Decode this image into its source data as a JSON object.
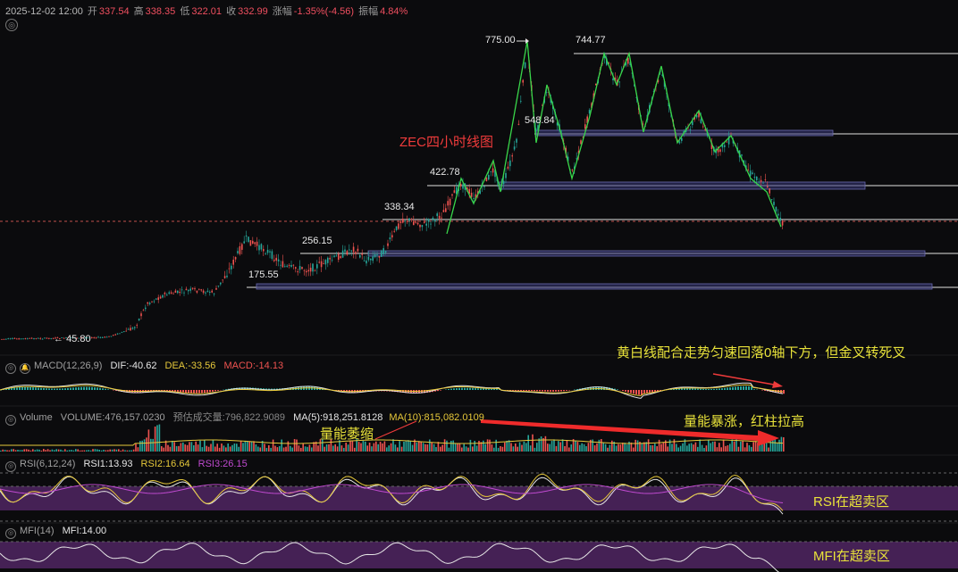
{
  "header": {
    "datetime": "2025-12-02 12:00",
    "open_label": "开",
    "open": "337.54",
    "high_label": "高",
    "high": "338.35",
    "low_label": "低",
    "low": "322.01",
    "close_label": "收",
    "close": "332.99",
    "change_label": "涨幅",
    "change": "-1.35%(-4.56)",
    "amplitude_label": "振幅",
    "amplitude": "4.84%"
  },
  "chart_title": "ZEC四小时线图",
  "price_labels": {
    "p775": "775.00",
    "p744": "744.77",
    "p548": "548.84",
    "p422": "422.78",
    "p338": "338.34",
    "p256": "256.15",
    "p175": "175.55",
    "p45": "45.80"
  },
  "macd": {
    "name": "MACD(12,26,9)",
    "dif": "DIF:-40.62",
    "dea": "DEA:-33.56",
    "macd": "MACD:-14.13",
    "annotation": "黄白线配合走势匀速回落0轴下方，但金叉转死叉"
  },
  "volume": {
    "name": "Volume",
    "volume": "VOLUME:476,157.0230",
    "est": "预估成交量:796,822.9089",
    "ma5": "MA(5):918,251.8128",
    "ma10": "MA(10):815,082.0109",
    "annotation_left": "量能萎缩",
    "annotation_right": "量能暴涨，红柱拉高"
  },
  "rsi": {
    "name": "RSI(6,12,24)",
    "rsi1": "RSI1:13.93",
    "rsi2": "RSI2:16.64",
    "rsi3": "RSI3:26.15",
    "zone": "RSI在超卖区"
  },
  "mfi": {
    "name": "MFI(14)",
    "value": "MFI:14.00",
    "zone": "MFI在超卖区"
  },
  "colors": {
    "up": "#26a69a",
    "down": "#ef5350",
    "accent_yellow": "#e8e23a",
    "accent_red": "#ef3b3b",
    "zone_purple": "#5a2a6e",
    "support_band": "#3a3a6e"
  }
}
